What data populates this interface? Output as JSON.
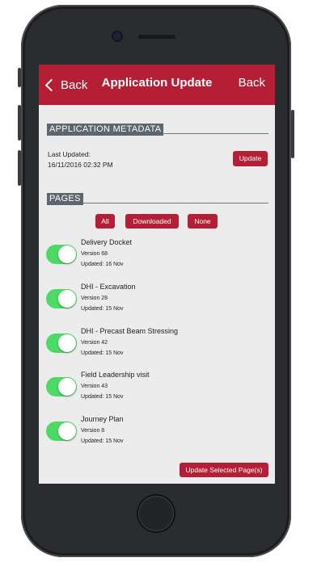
{
  "nav": {
    "back_left": "Back",
    "title": "Application Update",
    "back_right": "Back"
  },
  "metadata": {
    "section_title": "APPLICATION METADATA",
    "last_updated_label": "Last Updated:",
    "last_updated_value": "16/11/2016 02:32 PM",
    "update_label": "Update"
  },
  "pages": {
    "section_title": "PAGES",
    "filters": [
      "All",
      "Downloaded",
      "None"
    ],
    "items": [
      {
        "name": "Delivery Docket",
        "version": "Version 68",
        "updated": "Updated: 16 Nov",
        "enabled": true
      },
      {
        "name": "DHI - Excavation",
        "version": "Version 28",
        "updated": "Updated: 15 Nov",
        "enabled": true
      },
      {
        "name": "DHI - Precast Beam Stressing",
        "version": "Version 42",
        "updated": "Updated: 15 Nov",
        "enabled": true
      },
      {
        "name": "Field Leadership visit",
        "version": "Version 43",
        "updated": "Updated: 15 Nov",
        "enabled": true
      },
      {
        "name": "Journey Plan",
        "version": "Version 8",
        "updated": "Updated: 15 Nov",
        "enabled": true
      }
    ],
    "update_selected_label": "Update Selected Page(s)"
  },
  "colors": {
    "brand_red": "#b51f35",
    "section_gray": "#5c666e",
    "toggle_on": "#4cd964"
  }
}
